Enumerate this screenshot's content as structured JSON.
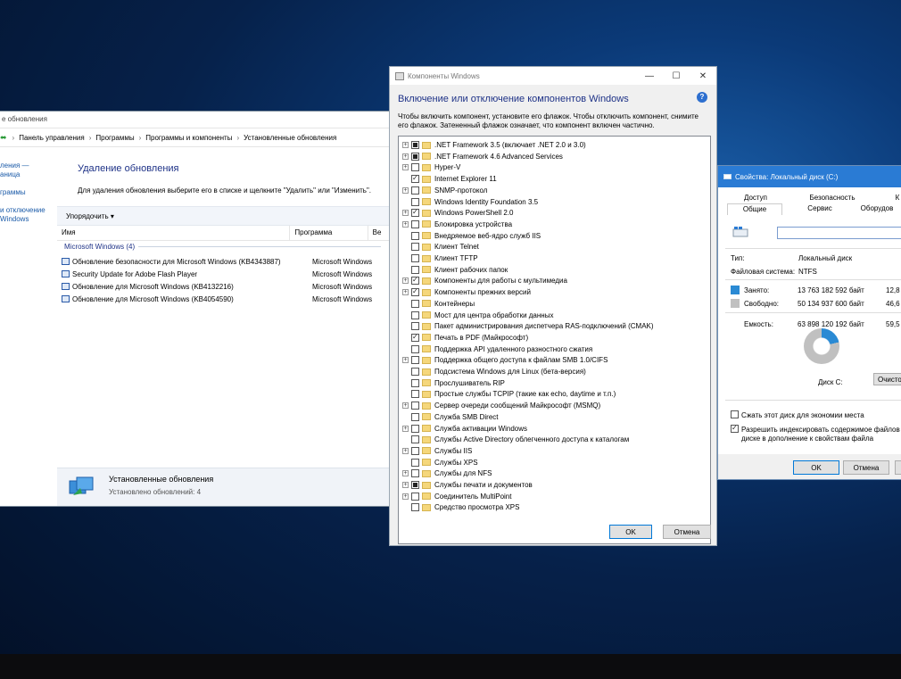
{
  "desktop": {
    "background": "#0b3a78"
  },
  "updates_window": {
    "title": "е обновления",
    "breadcrumbs": [
      "Панель управления",
      "Программы",
      "Программы и компоненты",
      "Установленные обновления"
    ],
    "left_nav": [
      "ления —\nаница",
      "граммы",
      "и отключение\nWindows"
    ],
    "heading": "Удаление обновления",
    "description": "Для удаления обновления выберите его в списке и щелкните \"Удалить\" или \"Изменить\".",
    "organize_label": "Упорядочить ▾",
    "columns": [
      "Имя",
      "Программа",
      "Ве"
    ],
    "group_label": "Microsoft Windows (4)",
    "rows": [
      {
        "name": "Обновление безопасности для Microsoft Windows (KB4343887)",
        "program": "Microsoft Windows"
      },
      {
        "name": "Security Update for Adobe Flash Player",
        "program": "Microsoft Windows"
      },
      {
        "name": "Обновление для Microsoft Windows (KB4132216)",
        "program": "Microsoft Windows"
      },
      {
        "name": "Обновление для Microsoft Windows (KB4054590)",
        "program": "Microsoft Windows"
      }
    ],
    "status_title": "Установленные обновления",
    "status_sub": "Установлено обновлений: 4"
  },
  "features_window": {
    "title": "Компоненты Windows",
    "minimize": "—",
    "maximize": "☐",
    "close": "✕",
    "heading": "Включение или отключение компонентов Windows",
    "help": "?",
    "description": "Чтобы включить компонент, установите его флажок. Чтобы отключить компонент, снимите его флажок. Затененный флажок означает, что компонент включен частично.",
    "items": [
      {
        "label": ".NET Framework 3.5 (включает .NET 2.0 и 3.0)",
        "expand": true,
        "state": "partial"
      },
      {
        "label": ".NET Framework 4.6 Advanced Services",
        "expand": true,
        "state": "partial"
      },
      {
        "label": "Hyper-V",
        "expand": true,
        "state": "none"
      },
      {
        "label": "Internet Explorer 11",
        "expand": false,
        "state": "checked"
      },
      {
        "label": "SNMP-протокол",
        "expand": true,
        "state": "none"
      },
      {
        "label": "Windows Identity Foundation 3.5",
        "expand": false,
        "state": "none"
      },
      {
        "label": "Windows PowerShell 2.0",
        "expand": true,
        "state": "checked"
      },
      {
        "label": "Блокировка устройства",
        "expand": true,
        "state": "none"
      },
      {
        "label": "Внедряемое веб-ядро служб IIS",
        "expand": false,
        "state": "none"
      },
      {
        "label": "Клиент Telnet",
        "expand": false,
        "state": "none"
      },
      {
        "label": "Клиент TFTP",
        "expand": false,
        "state": "none"
      },
      {
        "label": "Клиент рабочих папок",
        "expand": false,
        "state": "none"
      },
      {
        "label": "Компоненты для работы с мультимедиа",
        "expand": true,
        "state": "checked"
      },
      {
        "label": "Компоненты прежних версий",
        "expand": true,
        "state": "checked"
      },
      {
        "label": "Контейнеры",
        "expand": false,
        "state": "none"
      },
      {
        "label": "Мост для центра обработки данных",
        "expand": false,
        "state": "none"
      },
      {
        "label": "Пакет администрирования диспетчера RAS-подключений (CMAK)",
        "expand": false,
        "state": "none"
      },
      {
        "label": "Печать в PDF (Майкрософт)",
        "expand": false,
        "state": "checked"
      },
      {
        "label": "Поддержка API удаленного разностного сжатия",
        "expand": false,
        "state": "none"
      },
      {
        "label": "Поддержка общего доступа к файлам SMB 1.0/CIFS",
        "expand": true,
        "state": "none"
      },
      {
        "label": "Подсистема Windows для Linux (бета-версия)",
        "expand": false,
        "state": "none"
      },
      {
        "label": "Прослушиватель RIP",
        "expand": false,
        "state": "none"
      },
      {
        "label": "Простые службы TCPIP (такие как echo, daytime и т.п.)",
        "expand": false,
        "state": "none"
      },
      {
        "label": "Сервер очереди сообщений Майкрософт (MSMQ)",
        "expand": true,
        "state": "none"
      },
      {
        "label": "Служба SMB Direct",
        "expand": false,
        "state": "none"
      },
      {
        "label": "Служба активации Windows",
        "expand": true,
        "state": "none"
      },
      {
        "label": "Службы Active Directory облегченного доступа к каталогам",
        "expand": false,
        "state": "none"
      },
      {
        "label": "Службы IIS",
        "expand": true,
        "state": "none"
      },
      {
        "label": "Службы XPS",
        "expand": false,
        "state": "none"
      },
      {
        "label": "Службы для NFS",
        "expand": true,
        "state": "none"
      },
      {
        "label": "Службы печати и документов",
        "expand": true,
        "state": "partial"
      },
      {
        "label": "Соединитель MultiPoint",
        "expand": true,
        "state": "none"
      },
      {
        "label": "Средство просмотра XPS",
        "expand": false,
        "state": "none"
      }
    ],
    "ok_label": "OK",
    "cancel_label": "Отмена"
  },
  "disk_window": {
    "title": "Свойства: Локальный диск (C:)",
    "tabs_top": [
      "Доступ",
      "Безопасность",
      "К"
    ],
    "tabs_bottom": [
      "Общие",
      "Сервис",
      "Оборудов"
    ],
    "type_label": "Тип:",
    "type_value": "Локальный диск",
    "fs_label": "Файловая система:",
    "fs_value": "NTFS",
    "used_label": "Занято:",
    "used_bytes": "13 763 182 592 байт",
    "used_gb": "12,8",
    "free_label": "Свободно:",
    "free_bytes": "50 134 937 600 байт",
    "free_gb": "46,6",
    "capacity_label": "Емкость:",
    "capacity_bytes": "63 898 120 192 байт",
    "capacity_gb": "59,5",
    "used_fraction": 0.215,
    "used_color": "#2a8ad4",
    "free_color": "#c0c0c0",
    "disk_label": "Диск C:",
    "cleanup_label": "Очисто",
    "compress_label": "Сжать этот диск для экономии места",
    "index_label_1": "Разрешить индексировать содержимое файлов на",
    "index_label_2": "диске в дополнение к свойствам файла",
    "ok_label": "OK",
    "cancel_label": "Отмена"
  }
}
